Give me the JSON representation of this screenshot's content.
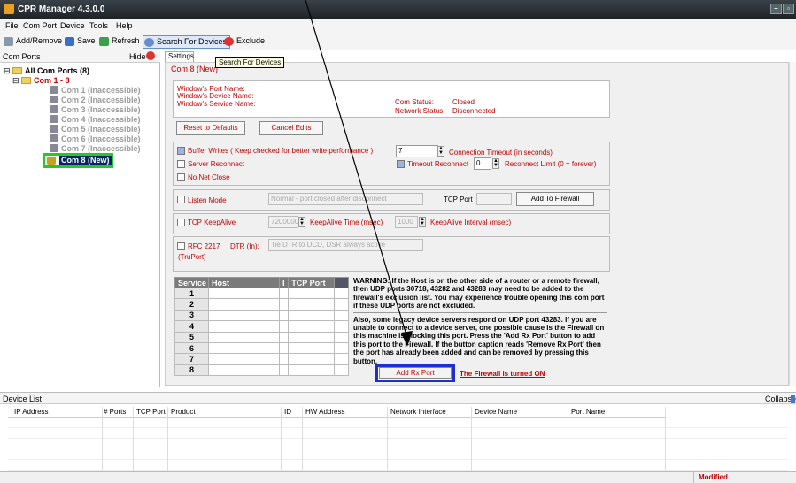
{
  "window": {
    "title": "CPR Manager 4.3.0.0"
  },
  "menu": [
    "File",
    "Com Port",
    "Device",
    "Tools",
    "Help"
  ],
  "toolbar": {
    "add_remove": "Add/Remove",
    "save": "Save",
    "refresh": "Refresh",
    "search": "Search For Devices",
    "exclude": "Exclude",
    "tooltip": "Search For Devices"
  },
  "left": {
    "header": "Com Ports",
    "hide": "Hide",
    "root": "All Com Ports (8)",
    "group": "Com 1 - 8",
    "items": [
      "Com 1 (Inaccessible)",
      "Com 2 (Inaccessible)",
      "Com 3 (Inaccessible)",
      "Com 4 (Inaccessible)",
      "Com 5 (Inaccessible)",
      "Com 6 (Inaccessible)",
      "Com 7 (Inaccessible)"
    ],
    "selected": "Com 8 (New)"
  },
  "settings": {
    "tab": "Settings",
    "title": "Com 8 (New)",
    "info": {
      "port_name": "Window's Port Name:",
      "device_name": "Window's Device Name:",
      "service_name": "Window's Service Name:",
      "com_status_label": "Com Status:",
      "com_status": "Closed",
      "net_status_label": "Network Status:",
      "net_status": "Disconnected"
    },
    "reset_btn": "Reset to Defaults",
    "cancel_btn": "Cancel Edits",
    "buffer_writes": "Buffer Writes  ( Keep checked for better write performance )",
    "server_reconnect": "Server Reconnect",
    "no_net_close": "No Net Close",
    "conn_timeout_value": "7",
    "conn_timeout_label": "Connection Timeout (in seconds)",
    "timeout_reconnect": "Timeout Reconnect",
    "reconnect_value": "0",
    "reconnect_label": "Reconnect Limit (0 = forever)",
    "listen_mode": "Listen Mode",
    "listen_mode_value": "Normal - port closed after disconnect",
    "tcp_port_label": "TCP Port",
    "add_firewall": "Add To Firewall",
    "tcp_keepalive": "TCP KeepAlive",
    "keepalive_time_value": "7200000",
    "keepalive_time_label": "KeepAlive Time (msec)",
    "keepalive_interval_value": "1000",
    "keepalive_interval_label": "KeepAlive Interval (msec)",
    "rfc_label": "RFC 2217",
    "truport": "(TruPort)",
    "dtr_label": "DTR (In):",
    "dtr_value": "Tie DTR to DCD, DSR always active"
  },
  "service_table": {
    "headers": [
      "Service",
      "Host",
      "I",
      "TCP Port"
    ],
    "rows": [
      "1",
      "2",
      "3",
      "4",
      "5",
      "6",
      "7",
      "8"
    ]
  },
  "warning": {
    "text1": "WARNING:  If the Host is on the other side of a router or a remote firewall, then UDP ports 30718, 43282 and 43283 may need to be added to the firewall's exclusion list.  You may experience trouble opening this com port if these UDP ports are not excluded.",
    "text2": "Also, some legacy device servers respond on UDP port 43283.  If you are unable to connect to a device server, one possible cause is the Firewall on this machine is blocking this port.  Press the 'Add Rx Port' button to add this port to the Firewall.   If the button caption reads 'Remove Rx Port' then the port has already been added and can be removed by pressing this button."
  },
  "add_rx_port": "Add Rx Port",
  "firewall_status": "The Firewall is turned ON",
  "device_list": {
    "header": "Device List",
    "collapse": "Collapse",
    "columns": [
      "IP Address",
      "# Ports",
      "TCP Port",
      "Product",
      "ID",
      "HW Address",
      "Network Interface",
      "Device Name",
      "Port Name"
    ]
  },
  "status": {
    "modified": "Modified"
  },
  "colors": {
    "accent_red": "#c00000",
    "selection_green": "#22cc22",
    "highlight_blue": "#1e2fd0"
  }
}
